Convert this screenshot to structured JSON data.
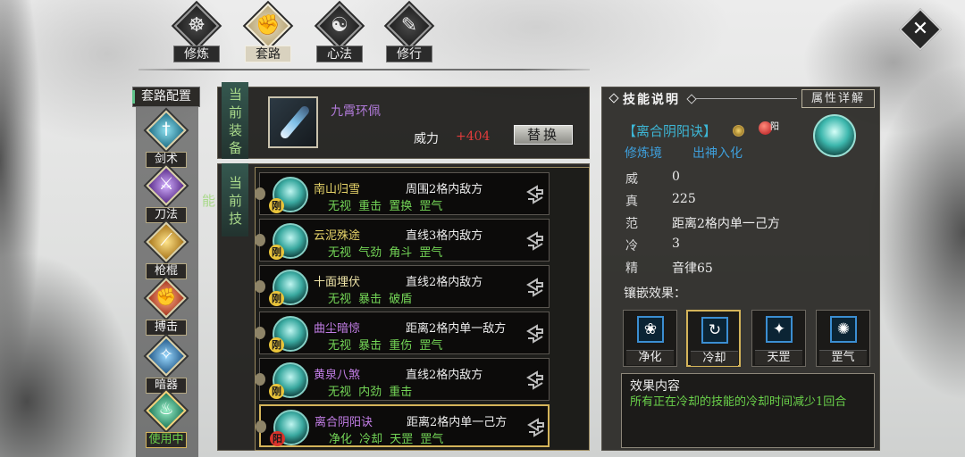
{
  "top_tabs": [
    {
      "label": "修炼",
      "icon": "cultivation-icon",
      "glyph": "☸",
      "selected": false
    },
    {
      "label": "套路",
      "icon": "fist-icon",
      "glyph": "✊",
      "selected": true
    },
    {
      "label": "心法",
      "icon": "yin-yang-icon",
      "glyph": "☯",
      "selected": false
    },
    {
      "label": "修行",
      "icon": "scroll-icon",
      "glyph": "✎",
      "selected": false
    }
  ],
  "close": {
    "icon": "close-icon",
    "glyph": "✕"
  },
  "sidebar": {
    "title": "套路配置",
    "items": [
      {
        "label": "剑术",
        "icon": "sword-icon",
        "glyph": "†",
        "selected": false
      },
      {
        "label": "刀法",
        "icon": "blade-icon",
        "glyph": "⚔",
        "selected": false
      },
      {
        "label": "枪棍",
        "icon": "spear-icon",
        "glyph": "⟋",
        "selected": false
      },
      {
        "label": "搏击",
        "icon": "fist-icon",
        "glyph": "✊",
        "selected": false
      },
      {
        "label": "暗器",
        "icon": "hidden-weapon-icon",
        "glyph": "✧",
        "selected": false
      },
      {
        "label": "使用中",
        "icon": "in-use-icon",
        "glyph": "♨",
        "selected": true
      }
    ]
  },
  "equipment": {
    "section_label": "当前装备",
    "item_name": "九霄环佩",
    "power_label": "威力",
    "power_value": "+404",
    "replace_button": "替换"
  },
  "skills": {
    "section_label": "当前技能",
    "list": [
      {
        "name": "南山归雪",
        "range": "周围2格内敌方",
        "tags": "无视 重击 置换 罡气",
        "badge": "刚",
        "name_color": "#e8d56a",
        "badge_color": "#e9c43a",
        "selected": false
      },
      {
        "name": "云泥殊途",
        "range": "直线3格内敌方",
        "tags": "无视 气劲 角斗 罡气",
        "badge": "刚",
        "name_color": "#e8d56a",
        "badge_color": "#e9c43a",
        "selected": false
      },
      {
        "name": "十面埋伏",
        "range": "直线2格内敌方",
        "tags": "无视 暴击 破盾",
        "badge": "刚",
        "name_color": "#efe4a8",
        "badge_color": "#e9c43a",
        "selected": false
      },
      {
        "name": "曲尘暗惊",
        "range": "距离2格内单一敌方",
        "tags": "无视 暴击 重伤 罡气",
        "badge": "刚",
        "name_color": "#c27ee6",
        "badge_color": "#e9c43a",
        "selected": false
      },
      {
        "name": "黄泉八煞",
        "range": "直线2格内敌方",
        "tags": "无视 内劲 重击",
        "badge": "刚",
        "name_color": "#c27ee6",
        "badge_color": "#e9c43a",
        "selected": false
      },
      {
        "name": "离合阴阳诀",
        "range": "距离2格内单一己方",
        "tags": "净化 冷却 天罡 罡气",
        "badge": "阳",
        "name_color": "#c27ee6",
        "badge_color": "#d9332b",
        "selected": true
      }
    ]
  },
  "detail": {
    "title": "技能说明",
    "attr_button": "属性详解",
    "skill_name": "【离合阴阳诀】",
    "element_badge": "阳",
    "realm_label": "修炼境",
    "realm_value": "出神入化",
    "stats": [
      {
        "label": "威",
        "value": "0"
      },
      {
        "label": "真",
        "value": "225"
      },
      {
        "label": "范",
        "value": "距离2格内单一己方"
      },
      {
        "label": "冷",
        "value": "3"
      },
      {
        "label": "精",
        "value": "音律65"
      }
    ],
    "inlay_label": "镶嵌效果：",
    "inlays": [
      {
        "label": "净化",
        "icon": "purify-icon",
        "glyph": "❀",
        "selected": false
      },
      {
        "label": "冷却",
        "icon": "cooldown-icon",
        "glyph": "↻",
        "selected": true
      },
      {
        "label": "天罡",
        "icon": "tiangang-icon",
        "glyph": "✦",
        "selected": false
      },
      {
        "label": "罡气",
        "icon": "gangqi-icon",
        "glyph": "✺",
        "selected": false
      }
    ],
    "effect_title": "效果内容",
    "effect_text": "所有正在冷却的技能的冷却时间减少1回合"
  },
  "colors": {
    "positive_green": "#6ad14a",
    "power_red": "#e23c3c",
    "epic_purple": "#c27ee6",
    "skill_cyan": "#3db7d6",
    "highlight_gold": "#d4b45a"
  }
}
